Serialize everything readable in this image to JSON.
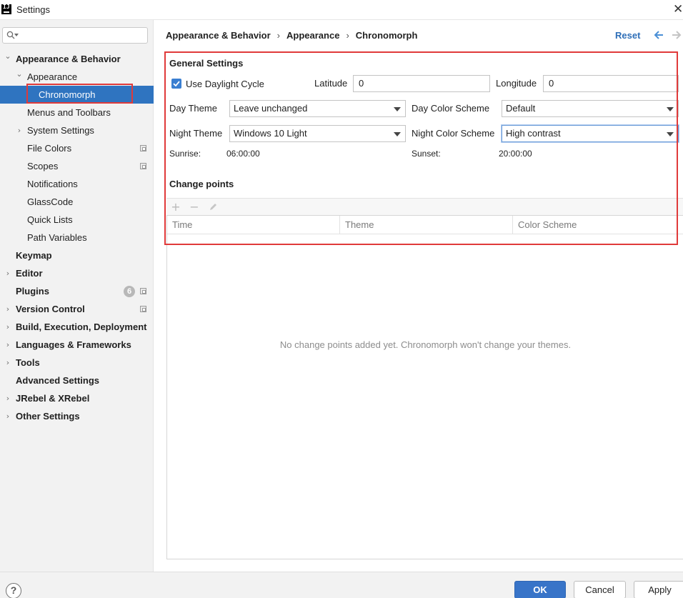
{
  "window": {
    "title": "Settings"
  },
  "search": {
    "placeholder": ""
  },
  "sidebar": {
    "items": [
      {
        "label": "Appearance & Behavior",
        "level": 0,
        "arrow": "down",
        "bold": true
      },
      {
        "label": "Appearance",
        "level": 1,
        "arrow": "down",
        "bold": false
      },
      {
        "label": "Chronomorph",
        "level": 2,
        "arrow": "",
        "bold": false,
        "selected": true,
        "highlighted": true
      },
      {
        "label": "Menus and Toolbars",
        "level": 1,
        "arrow": "",
        "bold": false
      },
      {
        "label": "System Settings",
        "level": 1,
        "arrow": "right",
        "bold": false
      },
      {
        "label": "File Colors",
        "level": 1,
        "arrow": "",
        "bold": false,
        "project_icon": true
      },
      {
        "label": "Scopes",
        "level": 1,
        "arrow": "",
        "bold": false,
        "project_icon": true
      },
      {
        "label": "Notifications",
        "level": 1,
        "arrow": "",
        "bold": false
      },
      {
        "label": "GlassCode",
        "level": 1,
        "arrow": "",
        "bold": false
      },
      {
        "label": "Quick Lists",
        "level": 1,
        "arrow": "",
        "bold": false
      },
      {
        "label": "Path Variables",
        "level": 1,
        "arrow": "",
        "bold": false
      },
      {
        "label": "Keymap",
        "level": 0,
        "arrow": "",
        "bold": true
      },
      {
        "label": "Editor",
        "level": 0,
        "arrow": "right",
        "bold": true
      },
      {
        "label": "Plugins",
        "level": 0,
        "arrow": "",
        "bold": true,
        "badge": "6",
        "project_icon": true
      },
      {
        "label": "Version Control",
        "level": 0,
        "arrow": "right",
        "bold": true,
        "project_icon": true
      },
      {
        "label": "Build, Execution, Deployment",
        "level": 0,
        "arrow": "right",
        "bold": true
      },
      {
        "label": "Languages & Frameworks",
        "level": 0,
        "arrow": "right",
        "bold": true
      },
      {
        "label": "Tools",
        "level": 0,
        "arrow": "right",
        "bold": true
      },
      {
        "label": "Advanced Settings",
        "level": 0,
        "arrow": "",
        "bold": true
      },
      {
        "label": "JRebel & XRebel",
        "level": 0,
        "arrow": "right",
        "bold": true
      },
      {
        "label": "Other Settings",
        "level": 0,
        "arrow": "right",
        "bold": true
      }
    ]
  },
  "breadcrumb": {
    "items": [
      "Appearance & Behavior",
      "Appearance",
      "Chronomorph"
    ],
    "separator": "›"
  },
  "header": {
    "reset_label": "Reset"
  },
  "general": {
    "title": "General Settings",
    "use_daylight_cycle": {
      "label": "Use Daylight Cycle",
      "checked": true
    },
    "latitude": {
      "label": "Latitude",
      "value": "0"
    },
    "longitude": {
      "label": "Longitude",
      "value": "0"
    },
    "day_theme": {
      "label": "Day Theme",
      "value": "Leave unchanged"
    },
    "day_color_scheme": {
      "label": "Day Color Scheme",
      "value": "Default"
    },
    "night_theme": {
      "label": "Night Theme",
      "value": "Windows 10 Light"
    },
    "night_color_scheme": {
      "label": "Night Color Scheme",
      "value": "High contrast"
    },
    "sunrise": {
      "label": "Sunrise:",
      "value": "06:00:00"
    },
    "sunset": {
      "label": "Sunset:",
      "value": "20:00:00"
    }
  },
  "change_points": {
    "title": "Change points",
    "toolbar": {
      "add": "+",
      "remove": "−"
    },
    "columns": [
      "Time",
      "Theme",
      "Color Scheme"
    ],
    "empty_text": "No change points added yet. Chronomorph won't change your themes."
  },
  "footer": {
    "help": "?",
    "ok_label": "OK",
    "cancel_label": "Cancel",
    "apply_label": "Apply"
  },
  "colors": {
    "accent": "#2f74c0",
    "highlight_box": "#e03a3a",
    "primary_button": "#3874c8",
    "link": "#2f6fb8"
  }
}
